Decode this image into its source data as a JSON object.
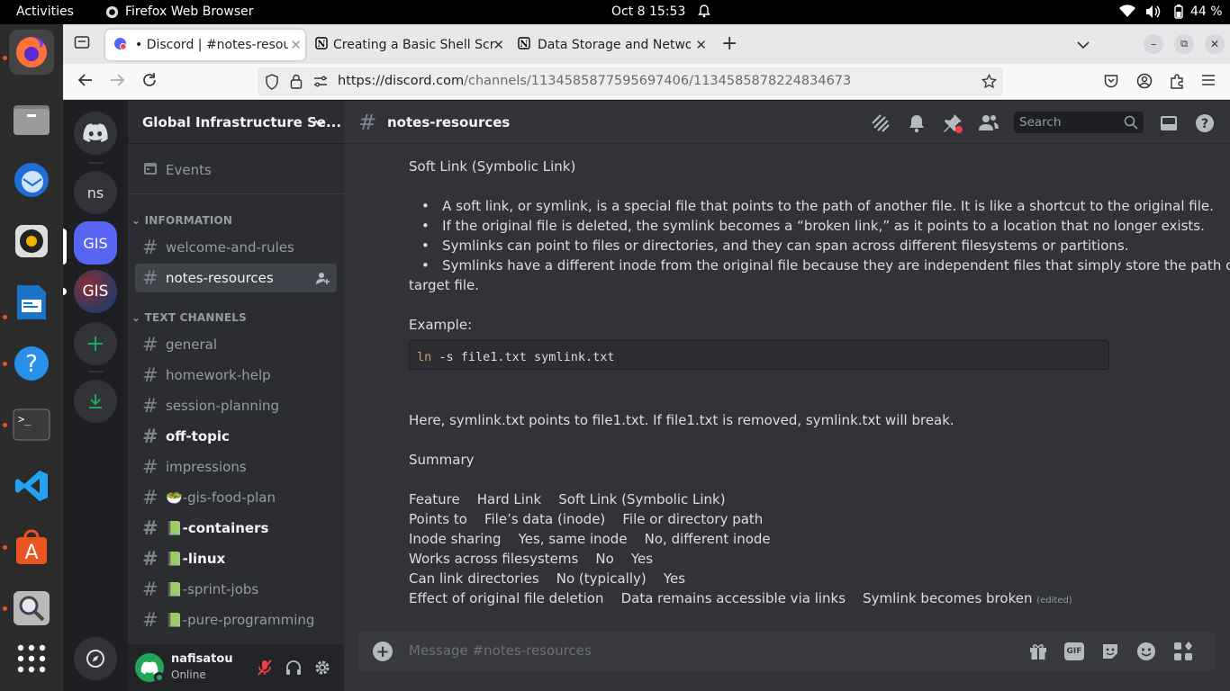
{
  "system": {
    "activities": "Activities",
    "app_name": "Firefox Web Browser",
    "datetime": "Oct 8  15:53",
    "battery": "44 %"
  },
  "browser": {
    "tabs": [
      {
        "label": "• Discord | #notes-resourc"
      },
      {
        "label": "Creating a Basic Shell Scr"
      },
      {
        "label": "Data Storage and Networ"
      }
    ],
    "url_domain": "https://discord.com",
    "url_path": "/channels/1134585877595697406/1134585878224834673"
  },
  "discord": {
    "server_name": "Global Infrastructure Se...",
    "events_label": "Events",
    "guilds": [
      "ns",
      "GIS",
      "GIS"
    ],
    "categories": {
      "information": "INFORMATION",
      "text_channels": "TEXT CHANNELS"
    },
    "info_channels": [
      {
        "name": "welcome-and-rules"
      },
      {
        "name": "notes-resources"
      }
    ],
    "text_channels": [
      {
        "name": "general"
      },
      {
        "name": "homework-help"
      },
      {
        "name": "session-planning"
      },
      {
        "name": "off-topic"
      },
      {
        "name": "impressions"
      },
      {
        "name": "🥗-gis-food-plan"
      },
      {
        "name": "📗-containers"
      },
      {
        "name": "📗-linux"
      },
      {
        "name": "📗-sprint-jobs"
      },
      {
        "name": "📗-pure-programming"
      }
    ],
    "user": {
      "name": "nafisatou",
      "status": "Online"
    },
    "channel_title": "notes-resources",
    "search_placeholder": "Search",
    "composer_placeholder": "Message #notes-resources",
    "gif_label": "GIF",
    "message": {
      "heading": "Soft Link (Symbolic Link)",
      "bullets": [
        "A soft link, or symlink, is a special file that points to the path of another file. It is like a shortcut to the original file.",
        "If the original file is deleted, the symlink becomes a “broken link,” as it points to a location that no longer exists.",
        "Symlinks can point to files or directories, and they can span across different filesystems or partitions.",
        "Symlinks have a different inode from the original file because they are independent files that simply store the path of the"
      ],
      "bullet_cont": "target file.",
      "example_label": "Example:",
      "code_cmd": "ln",
      "code_rest": " -s file1.txt symlink.txt",
      "explanation": "Here, symlink.txt points to file1.txt. If file1.txt is removed, symlink.txt will break.",
      "summary_label": "Summary",
      "table": [
        [
          "Feature",
          "Hard Link",
          "Soft Link (Symbolic Link)"
        ],
        [
          "Points to",
          "File’s data (inode)",
          "File or directory path"
        ],
        [
          "Inode sharing",
          "Yes, same inode",
          "No, different inode"
        ],
        [
          "Works across filesystems",
          "No",
          "Yes"
        ],
        [
          "Can link directories",
          "No (typically)",
          "Yes"
        ],
        [
          "Effect of original file deletion",
          "Data remains accessible via links",
          "Symlink becomes broken"
        ]
      ],
      "edited_tag": "(edited)"
    }
  },
  "colors": {
    "accent": "#5865f2",
    "online": "#23a559",
    "ubuntu": "#e95420"
  }
}
